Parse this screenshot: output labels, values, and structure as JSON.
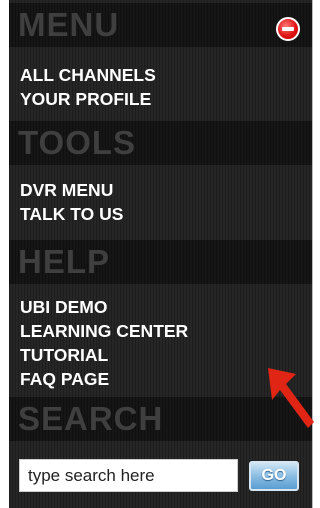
{
  "sections": [
    {
      "title": "MENU",
      "items": [
        "ALL CHANNELS",
        "YOUR PROFILE"
      ]
    },
    {
      "title": "TOOLS",
      "items": [
        "DVR MENU",
        "TALK TO US"
      ]
    },
    {
      "title": "HELP",
      "items": [
        "UBI DEMO",
        "LEARNING CENTER",
        "TUTORIAL",
        "FAQ PAGE"
      ]
    },
    {
      "title": "SEARCH",
      "items": []
    }
  ],
  "search": {
    "value": "type search here",
    "placeholder": "type search here",
    "go_label": "GO"
  },
  "icons": {
    "close": "minus-circle-icon",
    "arrow": "red-arrow-icon"
  },
  "colors": {
    "close": "#e11414",
    "arrow": "#e02515",
    "go": "#5a9ed3"
  }
}
